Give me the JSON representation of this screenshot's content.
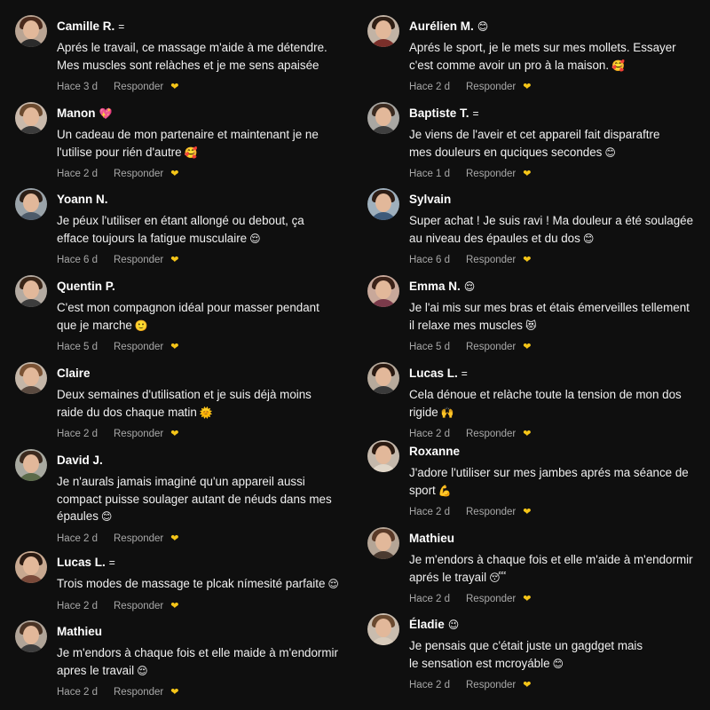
{
  "reply_label": "Responder",
  "like_icon": "yellow-heart-icon",
  "like_color": "#f5c518",
  "left_column": [
    {
      "name": "Camille R.",
      "name_emoji": "=",
      "text": "Aprés le travail, ce massage m'aide à me détendre.\nMes muscles sont relàches et je me sens apaisée",
      "emoji": "",
      "ago": "Hace 3 d",
      "avatar": {
        "hair": "#4a2a1c",
        "body": "#2b2b2b",
        "bg": "#b9a493"
      }
    },
    {
      "name": "Manon",
      "name_emoji": "💖",
      "text": "Un cadeau de mon partenaire et maintenant je ne\nl'utilise pour rién d'autre",
      "emoji": "🥰",
      "ago": "Hace 2 d",
      "avatar": {
        "hair": "#6b4a2f",
        "body": "#3b3b3b",
        "bg": "#c9b9ab"
      }
    },
    {
      "name": "Yoann N.",
      "name_emoji": "",
      "text": "Je péux l'utiliser en étant allongé ou debout, ça\nefface toujours la fatigue musculaire",
      "emoji": "😌",
      "ago": "Hace 6 d",
      "avatar": {
        "hair": "#2c1f17",
        "body": "#4d5b6a",
        "bg": "#9aa3a9"
      }
    },
    {
      "name": "Quentin P.",
      "name_emoji": "",
      "text": "C'est mon compagnon idéal pour masser pendant\nque je marche",
      "emoji": "🙂",
      "ago": "Hace 5 d",
      "avatar": {
        "hair": "#3a2618",
        "body": "#3d3d3d",
        "bg": "#b3aaa1"
      }
    },
    {
      "name": "Claire",
      "name_emoji": "",
      "text": "Deux semaines d'utilisation et je suis déjà moins\nraide du dos chaque matin",
      "emoji": "🌞",
      "ago": "Hace 2 d",
      "avatar": {
        "hair": "#7a5234",
        "body": "#5a4a40",
        "bg": "#c4b6a8"
      }
    },
    {
      "name": "David J.",
      "name_emoji": "",
      "text": "Je n'aurals jamais imaginé qu'un appareil aussi\ncompact puisse soulager autant de néuds dans mes\népaules",
      "emoji": "😊",
      "ago": "Hace 2 d",
      "avatar": {
        "hair": "#3b2a1e",
        "body": "#5b6b4a",
        "bg": "#a8a9a0"
      }
    },
    {
      "name": "Lucas L.",
      "name_emoji": "=",
      "text": "Trois modes de massage te plcak nímesité parfaite",
      "emoji": "😌",
      "ago": "Hace 2 d",
      "avatar": {
        "hair": "#2a1a12",
        "body": "#7a4a3a",
        "bg": "#c7a890"
      }
    },
    {
      "name": "Mathieu",
      "name_emoji": "",
      "text": "Je m'endors à chaque fois et elle maide à m'endormir\napres le travail",
      "emoji": "😌",
      "ago": "Hace 2 d",
      "avatar": {
        "hair": "#4a3324",
        "body": "#3e3e3e",
        "bg": "#b0a498"
      }
    }
  ],
  "right_column": [
    {
      "name": "Aurélien M.",
      "name_emoji": "😊",
      "text": "Aprés le sport, je le mets sur mes mollets. Essayer\nc'est comme avoir un pro à la maison.",
      "emoji": "🥰",
      "ago": "Hace 2 d",
      "avatar": {
        "hair": "#2f1f15",
        "body": "#7a2f2a",
        "bg": "#c2b3a5"
      }
    },
    {
      "name": "Baptiste T.",
      "name_emoji": "=",
      "text": "Je viens de l'aveir et cet appareil fait disparaftre\nmes douleurs en quciques secondes",
      "emoji": "😊",
      "ago": "Hace 1 d",
      "avatar": {
        "hair": "#3a2a20",
        "body": "#3f3f3f",
        "bg": "#a9a7a3"
      }
    },
    {
      "name": "Sylvain",
      "name_emoji": "",
      "text": "Super achat ! Je suis ravi ! Ma douleur a été soulagée\nau niveau des épaules et du dos",
      "emoji": "😊",
      "ago": "Hace 6 d",
      "avatar": {
        "hair": "#2c1c14",
        "body": "#3d5a7a",
        "bg": "#9fb0bd"
      }
    },
    {
      "name": "Emma N.",
      "name_emoji": "😌",
      "text": "Je l'ai mis sur mes bras et étais émerveilles tellement\nil relaxe mes muscles",
      "emoji": "😻",
      "ago": "Hace 5 d",
      "avatar": {
        "hair": "#3b2218",
        "body": "#7a3a4a",
        "bg": "#c8a89a"
      }
    },
    {
      "name": "Lucas L.",
      "name_emoji": "=",
      "text": "Cela dénoue et relàche toute la tension de mon dos\nrigide",
      "emoji": "🙌",
      "ago": "Hace 2 d",
      "avatar": {
        "hair": "#2a1a12",
        "body": "#3a3a3a",
        "bg": "#b7aa9c"
      }
    },
    {
      "name": "Roxanne",
      "name_emoji": "",
      "text": "J'adore l'utiliser sur mes jambes aprés ma séance de\nsport",
      "emoji": "💪",
      "ago": "Hace 2 d",
      "avatar": {
        "hair": "#2b1a10",
        "body": "#e0d6c8",
        "bg": "#c4b8ab"
      }
    },
    {
      "name": "Mathieu",
      "name_emoji": "",
      "text": "Je m'endors à chaque fois et elle m'aide à m'endormir\naprés le trayail",
      "emoji": "😴",
      "ago": "Hace 2 d",
      "avatar": {
        "hair": "#5a3a28",
        "body": "#4a3a30",
        "bg": "#b5a596"
      }
    },
    {
      "name": "Éladie",
      "name_emoji": "😉",
      "text": "Je pensais que c'était juste un gagdget mais\nle sensation est mcroyáble",
      "emoji": "😊",
      "ago": "Hace 2 d",
      "avatar": {
        "hair": "#6a4a30",
        "body": "#d8cbbb",
        "bg": "#c9bcae"
      }
    }
  ]
}
